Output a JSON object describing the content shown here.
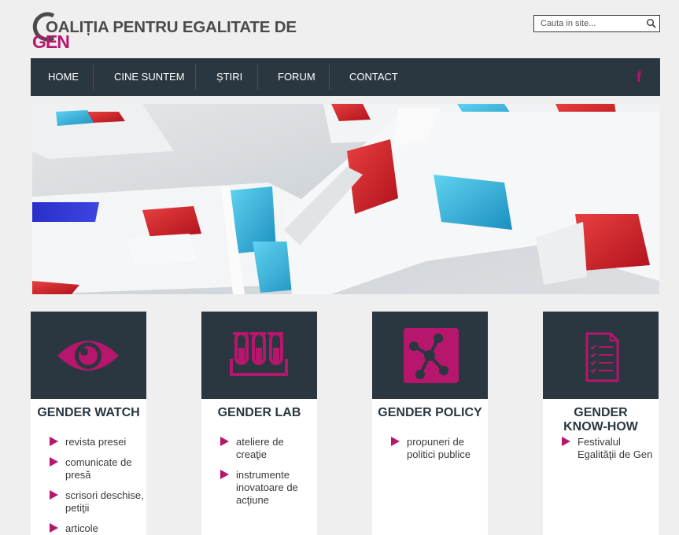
{
  "logo": {
    "line1": "OALIȚIA PENTRU EGALITATE DE",
    "line2": "GEN"
  },
  "search": {
    "placeholder": "Cauta in site..."
  },
  "nav": {
    "items": [
      {
        "label": "HOME"
      },
      {
        "label": "CINE SUNTEM"
      },
      {
        "label": "ȘTIRI"
      },
      {
        "label": "FORUM"
      },
      {
        "label": "CONTACT"
      }
    ],
    "social": "f"
  },
  "cards": [
    {
      "title": "GENDER WATCH",
      "icon": "eye-icon",
      "items": [
        "revista presei",
        "comunicate de presă",
        "scrisori deschise, petiţii",
        "articole"
      ]
    },
    {
      "title": "GENDER LAB",
      "icon": "test-tubes-icon",
      "items": [
        "ateliere de creaţie",
        "instrumente inovatoare de acţiune"
      ]
    },
    {
      "title": "GENDER POLICY",
      "icon": "network-icon",
      "items": [
        "propuneri de politici publice"
      ]
    },
    {
      "title": "GENDER KNOW-HOW",
      "icon": "checklist-icon",
      "items": [
        "Festivalul Egalităţii de Gen"
      ]
    }
  ],
  "colors": {
    "accent": "#b7166d",
    "dark": "#2a3740",
    "background": "#efefef"
  }
}
